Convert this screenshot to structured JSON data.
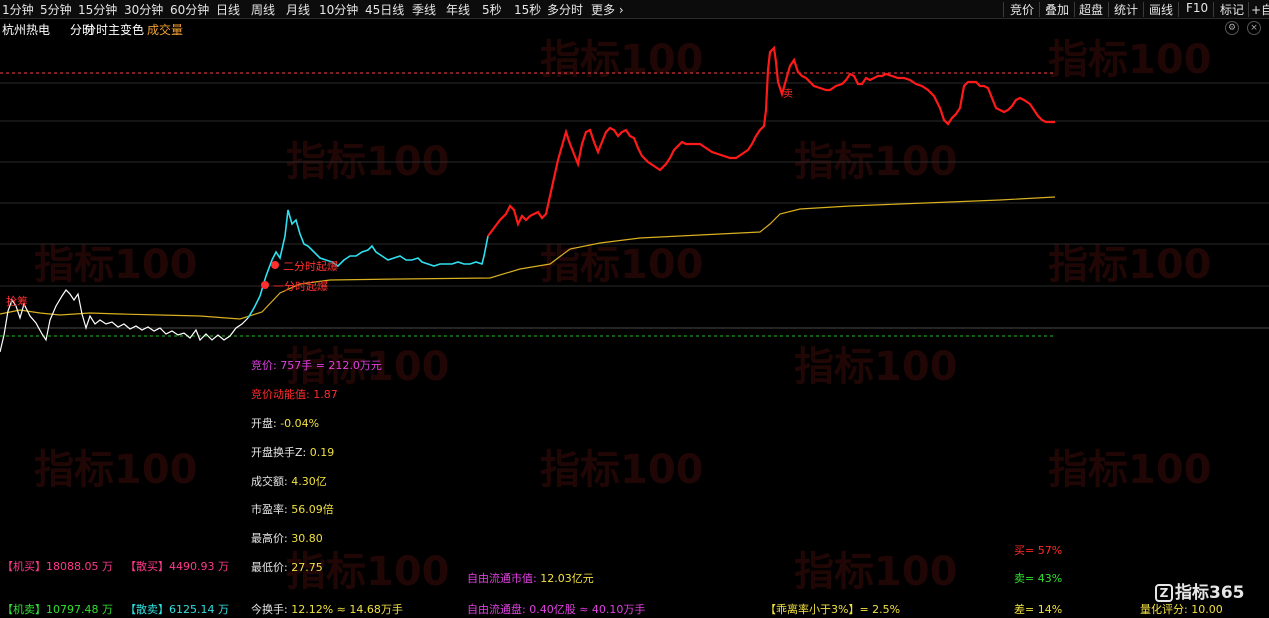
{
  "toolbar": {
    "periods": [
      "1分钟",
      "5分钟",
      "15分钟",
      "30分钟",
      "60分钟",
      "日线",
      "周线",
      "月线",
      "10分钟",
      "45日线",
      "季线",
      "年线",
      "5秒",
      "15秒",
      "多分时",
      "更多"
    ],
    "tools": [
      "竞价",
      "叠加",
      "超盘",
      "统计",
      "画线",
      "F10",
      "标记",
      "+自"
    ]
  },
  "header": {
    "stock_name": "杭州热电",
    "indicator_a": "分时",
    "indicator_b": "分时主变色",
    "indicator_c": "成交量"
  },
  "watermark": "指标100",
  "signals": {
    "first": "抢筹",
    "second": "二分时起爆",
    "third": "一分时起爆",
    "high": "卖"
  },
  "stats": {
    "bid": "竞价: 757手 = 212.0万元",
    "bid_energy_label": "竞价动能值: ",
    "bid_energy": "1.87",
    "open_label": "开盘: ",
    "open": "-0.04%",
    "open_turnover_label": "开盘换手Z: ",
    "open_turnover": "0.19",
    "amount_label": "成交额: ",
    "amount": "4.30亿",
    "pe_label": "市盈率: ",
    "pe": "56.09倍",
    "high_label": "最高价: ",
    "high": "30.80",
    "low_label": "最低价: ",
    "low": "27.75",
    "turnover_label": "今换手: ",
    "turnover": "12.12% ≈ 14.68万手",
    "float_mv_label": "自由流通市值: ",
    "float_mv": "12.03亿元",
    "float_shares_label": "自由流通盘: ",
    "float_shares": "0.40亿股 ≈ 40.10万手",
    "deviation_label": "【乖离率小于3%】= ",
    "deviation": "2.5%",
    "buy_ratio": "买= 57%",
    "sell_ratio": "卖= 43%",
    "diff_ratio": "差= 14%",
    "score_label": "量化评分: ",
    "score": "10.00",
    "inst_buy_label": "【机买】",
    "inst_buy": "18088.05 万",
    "retail_buy_label": "【散买】",
    "retail_buy": "4490.93 万",
    "inst_sell_label": "【机卖】",
    "inst_sell": "10797.48 万",
    "retail_sell_label": "【散卖】",
    "retail_sell": "6125.14 万"
  },
  "logo": {
    "mark": "Z",
    "text": "指标365"
  },
  "colors": {
    "price_white": "#ffffff",
    "price_cyan": "#30e0f0",
    "price_red": "#ff1a1a",
    "avg_line": "#d8b020",
    "high_dash": "#ff4040",
    "low_dash": "#20c020"
  }
}
